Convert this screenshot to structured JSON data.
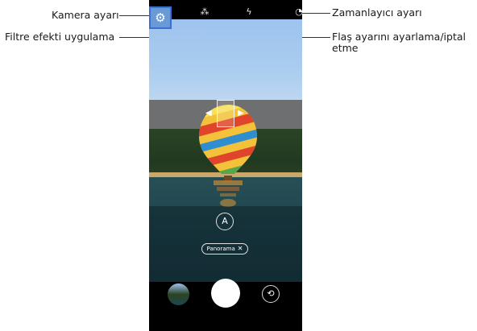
{
  "callouts": {
    "camera_settings": "Kamera ayarı",
    "filter_effect": "Filtre efekti uygulama",
    "timer": "Zamanlayıcı ayarı",
    "flash_line1": "Flaş ayarını ayarlama/iptal",
    "flash_line2": "etme"
  },
  "mode": {
    "pill_label": "Panorama",
    "pill_close": "✕",
    "mode_icon": "A"
  },
  "icons": {
    "settings": "gear-icon",
    "filter": "filter-icon",
    "flash": "flash-icon",
    "timer": "timer-icon",
    "switch_camera": "switch-camera-icon"
  },
  "colors": {
    "highlight": "#3b6fd6"
  }
}
